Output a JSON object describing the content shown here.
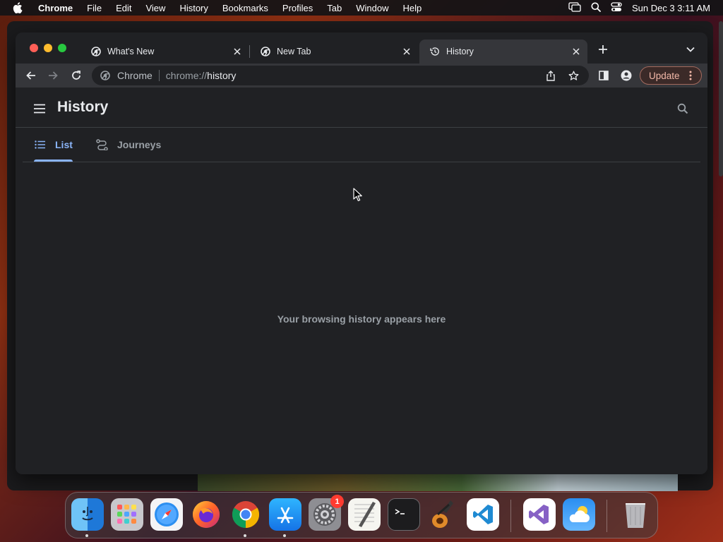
{
  "menubar": {
    "app_name": "Chrome",
    "items": [
      "File",
      "Edit",
      "View",
      "History",
      "Bookmarks",
      "Profiles",
      "Tab",
      "Window",
      "Help"
    ],
    "clock": "Sun Dec 3  3:11 AM"
  },
  "browser": {
    "tabs": [
      {
        "title": "What's New",
        "icon": "chrome-icon",
        "active": false
      },
      {
        "title": "New Tab",
        "icon": "chrome-icon",
        "active": false
      },
      {
        "title": "History",
        "icon": "history-icon",
        "active": true
      }
    ],
    "omnibox": {
      "site_name": "Chrome",
      "url_scheme": "chrome://",
      "url_path": "history"
    },
    "update_label": "Update"
  },
  "history_page": {
    "title": "History",
    "tabs": [
      {
        "label": "List",
        "active": true
      },
      {
        "label": "Journeys",
        "active": false
      }
    ],
    "empty_message": "Your browsing history appears here"
  },
  "dock": {
    "apps": [
      "Finder",
      "Launchpad",
      "Safari",
      "Firefox",
      "Chrome",
      "App Store",
      "System Settings",
      "TextEdit",
      "Terminal",
      "GarageBand",
      "Visual Studio Code",
      "Visual Studio",
      "Weather",
      "Trash"
    ],
    "settings_badge": "1"
  },
  "colors": {
    "accent": "#8ab4f8",
    "window_bg": "#202124",
    "toolbar_bg": "#35363a",
    "update_text": "#f2b8a8"
  }
}
